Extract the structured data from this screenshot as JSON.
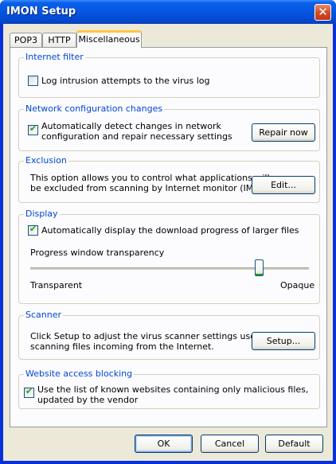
{
  "window": {
    "title": "IMON Setup"
  },
  "tabs": [
    {
      "label": "POP3"
    },
    {
      "label": "HTTP"
    },
    {
      "label": "Miscellaneous"
    }
  ],
  "internet_filter": {
    "title": "Internet filter",
    "log_label": "Log intrusion attempts to the virus log",
    "log_checked": false
  },
  "network": {
    "title": "Network configuration changes",
    "detect_line1": "Automatically detect changes in network",
    "detect_line2": "configuration and repair necessary settings",
    "detect_checked": true,
    "repair_label": "Repair now"
  },
  "exclusion": {
    "title": "Exclusion",
    "desc_line1": "This option allows you to control what applications will",
    "desc_line2": "be excluded from scanning by Internet monitor (IMON).",
    "edit_label": "Edit..."
  },
  "display": {
    "title": "Display",
    "progress_label": "Automatically display the download progress of larger files",
    "progress_checked": true,
    "transparency_label": "Progress window transparency",
    "min_label": "Transparent",
    "max_label": "Opaque",
    "slider_value": 0.82
  },
  "scanner": {
    "title": "Scanner",
    "desc_line1": "Click Setup to adjust the virus scanner settings used for",
    "desc_line2": "scanning files incoming from the Internet.",
    "setup_label": "Setup..."
  },
  "website_blocking": {
    "title": "Website access blocking",
    "use_line1": "Use the list of known websites containing only malicious files,",
    "use_line2": "updated by the vendor",
    "use_checked": true
  },
  "buttons": {
    "ok": "OK",
    "cancel": "Cancel",
    "default": "Default"
  },
  "colors": {
    "titlebar": "#0556e0",
    "group_title": "#0046d5",
    "check_mark": "#21a121",
    "face": "#ece9d8"
  }
}
